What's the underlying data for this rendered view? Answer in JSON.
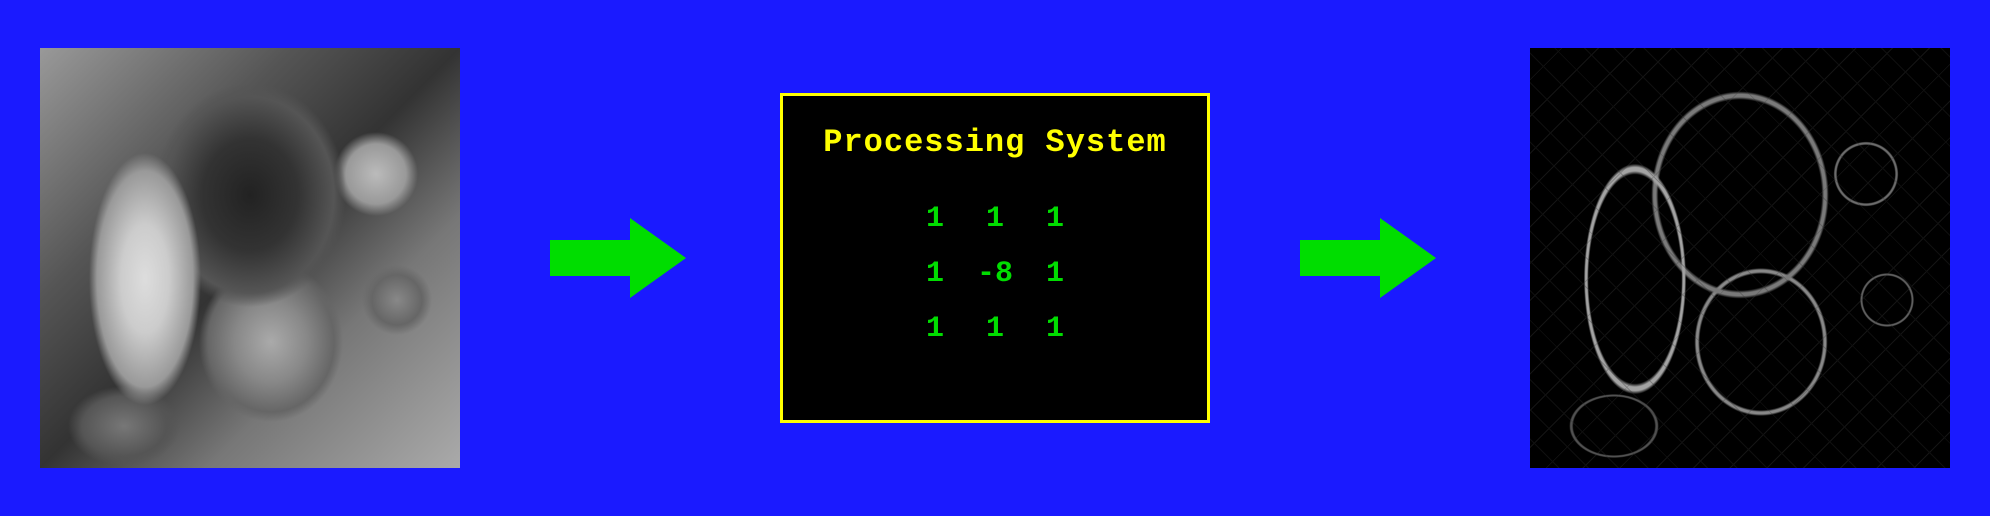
{
  "processing": {
    "title": "Processing System",
    "kernel": {
      "rows": 3,
      "cols": 3,
      "values": [
        "1",
        "1",
        "1",
        "1",
        "-8",
        "1",
        "1",
        "1",
        "1"
      ]
    }
  },
  "diagram": {
    "input_label": "input-grayscale-image",
    "output_label": "output-edge-detected-image",
    "operation": "laplacian-edge-detection"
  }
}
